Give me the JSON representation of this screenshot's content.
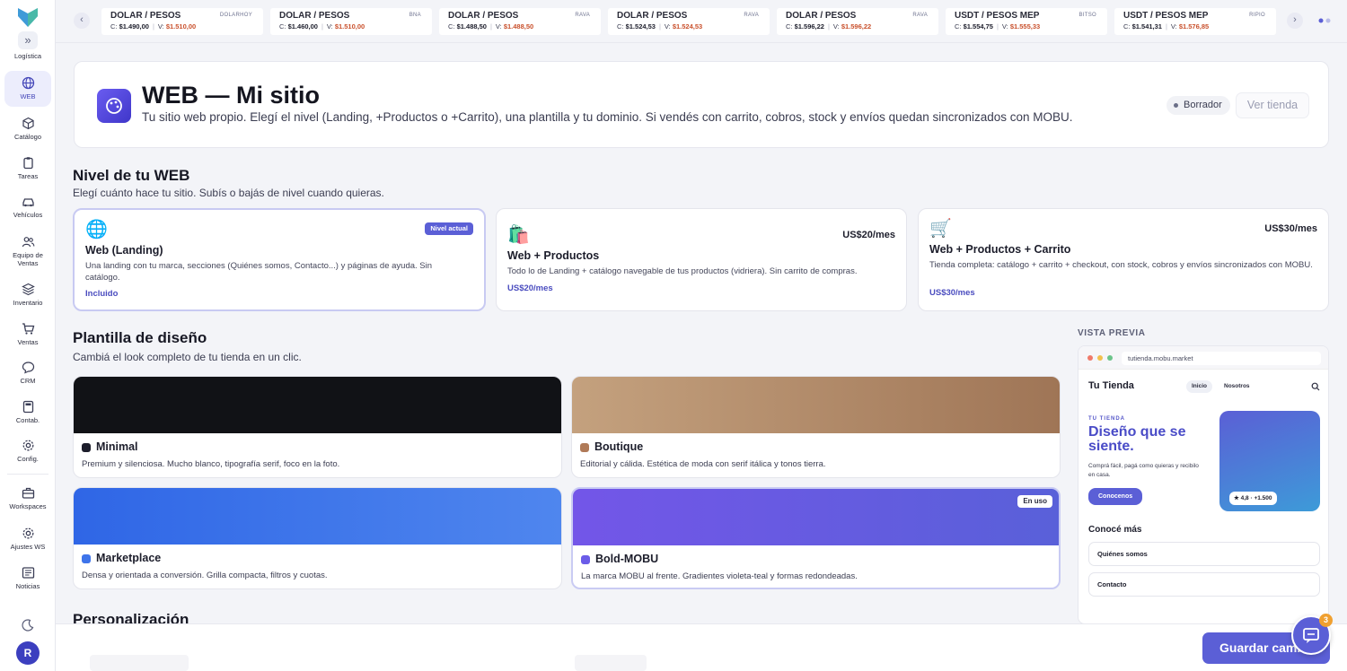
{
  "sidebar": {
    "items": [
      {
        "label": "Logística",
        "icon": "truck-icon"
      },
      {
        "label": "WEB",
        "icon": "globe-icon",
        "active": true
      },
      {
        "label": "Catálogo",
        "icon": "box-icon"
      },
      {
        "label": "Tareas",
        "icon": "clipboard-icon"
      },
      {
        "label": "Vehículos",
        "icon": "car-icon"
      },
      {
        "label": "Equipo de Ventas",
        "icon": "users-icon"
      },
      {
        "label": "Inventario",
        "icon": "layers-icon"
      },
      {
        "label": "Ventas",
        "icon": "cart-icon"
      },
      {
        "label": "CRM",
        "icon": "chat-icon"
      },
      {
        "label": "Contab.",
        "icon": "calculator-icon"
      },
      {
        "label": "Config.",
        "icon": "gear-icon"
      },
      {
        "label": "Workspaces",
        "icon": "briefcase-icon"
      },
      {
        "label": "Ajustes WS",
        "icon": "settings-icon"
      },
      {
        "label": "Noticias",
        "icon": "newspaper-icon"
      }
    ],
    "avatar_initial": "R"
  },
  "tickers": [
    {
      "title": "DOLAR / PESOS",
      "source": "DOLARHOY",
      "buy_label": "C:",
      "buy": "$1.490,00",
      "sell_label": "V:",
      "sell": "$1.510,00"
    },
    {
      "title": "DOLAR / PESOS",
      "source": "BNA",
      "buy_label": "C:",
      "buy": "$1.460,00",
      "sell_label": "V:",
      "sell": "$1.510,00"
    },
    {
      "title": "DOLAR / PESOS",
      "source": "RAVA",
      "buy_label": "C:",
      "buy": "$1.488,50",
      "sell_label": "V:",
      "sell": "$1.488,50"
    },
    {
      "title": "DOLAR / PESOS",
      "source": "RAVA",
      "buy_label": "C:",
      "buy": "$1.524,53",
      "sell_label": "V:",
      "sell": "$1.524,53"
    },
    {
      "title": "DOLAR / PESOS",
      "source": "RAVA",
      "buy_label": "C:",
      "buy": "$1.596,22",
      "sell_label": "V:",
      "sell": "$1.596,22"
    },
    {
      "title": "USDT / PESOS MEP",
      "source": "BITSO",
      "buy_label": "C:",
      "buy": "$1.554,75",
      "sell_label": "V:",
      "sell": "$1.555,33"
    },
    {
      "title": "USDT / PESOS MEP",
      "source": "RIPIO",
      "buy_label": "C:",
      "buy": "$1.541,31",
      "sell_label": "V:",
      "sell": "$1.576,85"
    }
  ],
  "header": {
    "title": "WEB — Mi sitio",
    "subtitle": "Tu sitio web propio. Elegí el nivel (Landing, +Productos o +Carrito), una plantilla y tu dominio. Si vendés con carrito, cobros, stock y envíos quedan sincronizados con MOBU.",
    "status": "Borrador",
    "view_button": "Ver tienda"
  },
  "level_section": {
    "title": "Nivel de tu WEB",
    "subtitle": "Elegí cuánto hace tu sitio. Subís o bajás de nivel cuando quieras.",
    "plans": [
      {
        "emoji": "🌐",
        "name": "Web (Landing)",
        "description": "Una landing con tu marca, secciones (Quiénes somos, Contacto...) y páginas de ayuda. Sin catálogo.",
        "footer": "Incluido",
        "badge": "Nivel actual",
        "price": ""
      },
      {
        "emoji": "🛍️",
        "name": "Web + Productos",
        "description": "Todo lo de Landing + catálogo navegable de tus productos (vidriera). Sin carrito de compras.",
        "footer": "US$20/mes",
        "badge": "",
        "price": "US$20/mes"
      },
      {
        "emoji": "🛒",
        "name": "Web + Productos + Carrito",
        "description": "Tienda completa: catálogo + carrito + checkout, con stock, cobros y envíos sincronizados con MOBU.",
        "footer": "US$30/mes",
        "badge": "",
        "price": "US$30/mes"
      }
    ]
  },
  "template_section": {
    "title": "Plantilla de diseño",
    "subtitle": "Cambiá el look completo de tu tienda en un clic.",
    "templates": [
      {
        "name": "Minimal",
        "description": "Premium y silenciosa. Mucho blanco, tipografía serif, foco en la foto.",
        "color": "#111216",
        "dot": "#1c1d2b",
        "badge": ""
      },
      {
        "name": "Boutique",
        "description": "Editorial y cálida. Estética de moda con serif itálica y tonos tierra.",
        "color": "#b48a68",
        "dot": "#b07a58",
        "badge": ""
      },
      {
        "name": "Marketplace",
        "description": "Densa y orientada a conversión. Grilla compacta, filtros y cuotas.",
        "color": "#3e74ea",
        "dot": "#3e74ea",
        "badge": ""
      },
      {
        "name": "Bold-MOBU",
        "description": "La marca MOBU al frente. Gradientes violeta-teal y formas redondeadas.",
        "color": "#6b5ce8",
        "dot": "#6b5ce8",
        "badge": "En uso"
      }
    ]
  },
  "preview": {
    "label": "VISTA PREVIA",
    "url": "tutienda.mobu.market",
    "brand": "Tu Tienda",
    "nav": [
      "Inicio",
      "Nosotros"
    ],
    "kicker": "TU TIENDA",
    "hero": "Diseño que se siente.",
    "copy": "Comprá fácil, pagá como quieras y recibilo en casa.",
    "cta": "Conocenos",
    "rating": "★ 4,8 · +1.500",
    "more_title": "Conocé más",
    "links": [
      "Quiénes somos",
      "Contacto"
    ]
  },
  "personalization": {
    "title": "Personalización"
  },
  "actions": {
    "save": "Guardar cambios",
    "chat_badge": "3"
  },
  "colors": {
    "accent": "#5b5fd6",
    "sell": "#c9502c"
  }
}
